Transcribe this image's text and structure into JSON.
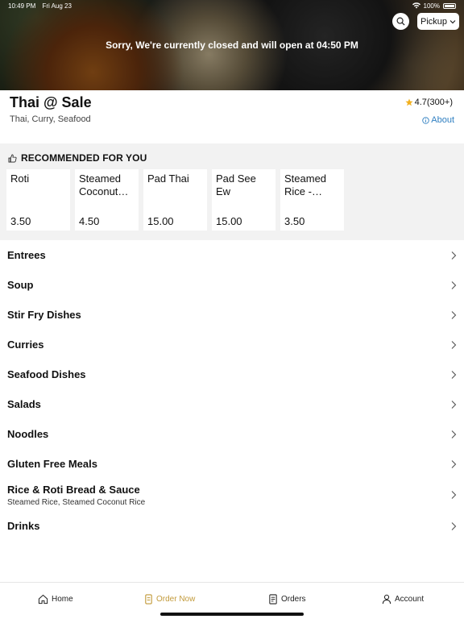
{
  "status": {
    "time": "10:49 PM",
    "date": "Fri Aug 23",
    "battery": "100%"
  },
  "hero": {
    "closed_message": "Sorry, We're currently closed and will open at 04:50 PM",
    "pickup_label": "Pickup"
  },
  "restaurant": {
    "name": "Thai @ Sale",
    "cuisine": "Thai, Curry, Seafood",
    "rating": "4.7(300+)",
    "about_label": "About"
  },
  "recommended": {
    "title": "RECOMMENDED FOR YOU",
    "items": [
      {
        "name": "Roti",
        "price": "3.50"
      },
      {
        "name": "Steamed Coconut Rice",
        "price": "4.50"
      },
      {
        "name": "Pad Thai",
        "price": "15.00"
      },
      {
        "name": "Pad See Ew",
        "price": "15.00"
      },
      {
        "name": "Steamed Rice - Large",
        "price": "3.50"
      }
    ]
  },
  "categories": [
    {
      "name": "Entrees"
    },
    {
      "name": "Soup"
    },
    {
      "name": "Stir Fry Dishes"
    },
    {
      "name": "Curries"
    },
    {
      "name": "Seafood Dishes"
    },
    {
      "name": "Salads"
    },
    {
      "name": "Noodles"
    },
    {
      "name": "Gluten Free Meals"
    },
    {
      "name": "Rice & Roti Bread & Sauce",
      "subtitle": "Steamed Rice, Steamed Coconut Rice"
    },
    {
      "name": "Drinks"
    }
  ],
  "tabs": [
    {
      "label": "Home",
      "icon": "home-icon"
    },
    {
      "label": "Order Now",
      "icon": "order-icon"
    },
    {
      "label": "Orders",
      "icon": "receipt-icon"
    },
    {
      "label": "Account",
      "icon": "person-icon"
    }
  ],
  "colors": {
    "accent": "#c29a3a",
    "link": "#2f7fc1",
    "star": "#f2b01e"
  }
}
